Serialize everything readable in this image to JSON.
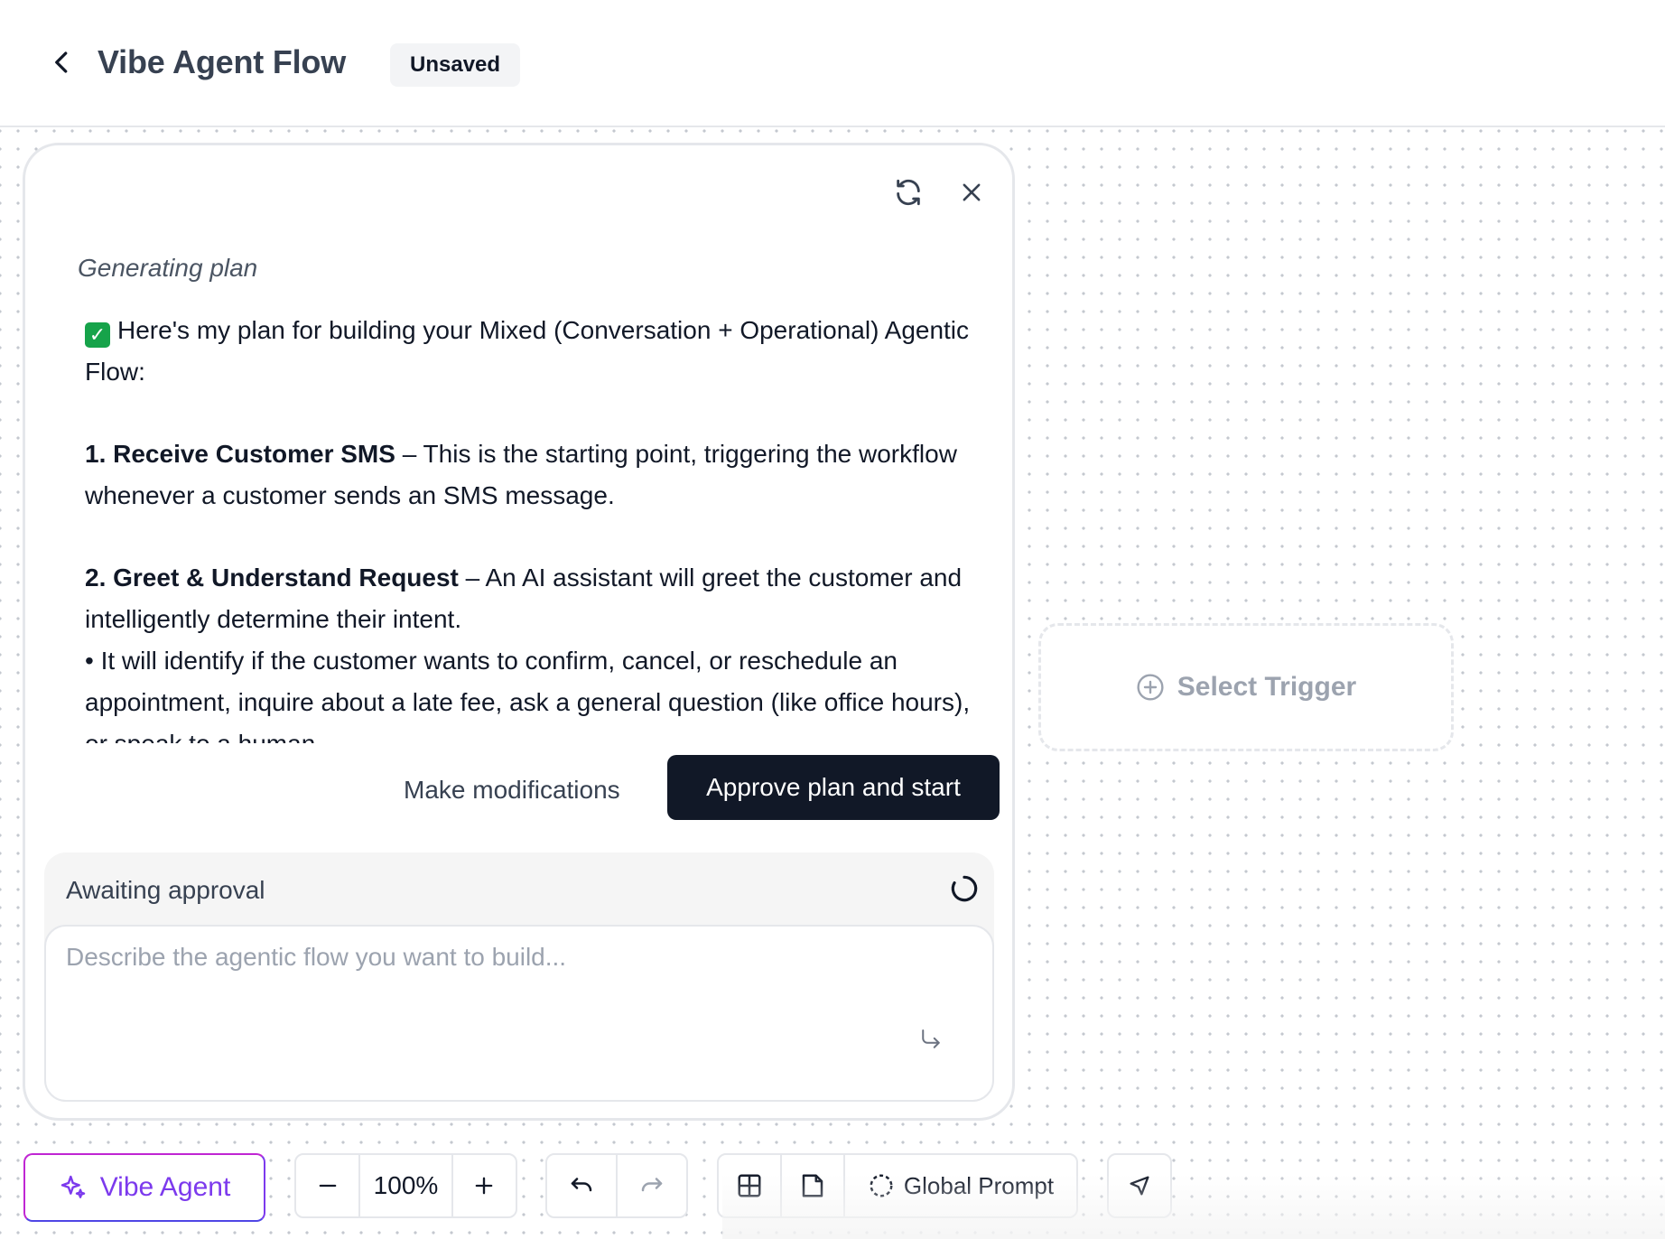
{
  "header": {
    "title": "Vibe Agent Flow",
    "status_badge": "Unsaved"
  },
  "panel": {
    "generating_label": "Generating plan",
    "plan": {
      "intro": "Here's my plan for building your Mixed (Conversation + Operational) Agentic Flow:",
      "step1_title": "1. Receive Customer SMS",
      "step1_text": " – This is the starting point, triggering the workflow whenever a customer sends an SMS message.",
      "step2_title": "2. Greet & Understand Request",
      "step2_text": " – An AI assistant will greet the customer and intelligently determine their intent.",
      "step2_bullet": "• It will identify if the customer wants to confirm, cancel, or reschedule an appointment, inquire about a late fee, ask a general question (like office hours), or speak to a human."
    },
    "modify_button": "Make modifications",
    "approve_button": "Approve plan and start",
    "status_text": "Awaiting approval",
    "input_placeholder": "Describe the agentic flow you want to build..."
  },
  "canvas": {
    "trigger_label": "Select Trigger"
  },
  "toolbar": {
    "vibe_agent_label": "Vibe Agent",
    "zoom_level": "100%",
    "global_prompt_label": "Global Prompt"
  },
  "colors": {
    "primary_dark": "#111827",
    "accent_purple": "#7c3aed",
    "check_green": "#16a34a"
  },
  "icons": [
    "chevron-left-icon",
    "refresh-icon",
    "close-icon",
    "spinner-icon",
    "send-icon",
    "plus-circle-icon",
    "sparkle-icon",
    "minus-icon",
    "plus-icon",
    "undo-icon",
    "redo-icon",
    "grid-icon",
    "note-icon",
    "dashed-circle-icon",
    "cursor-icon",
    "check-icon"
  ]
}
